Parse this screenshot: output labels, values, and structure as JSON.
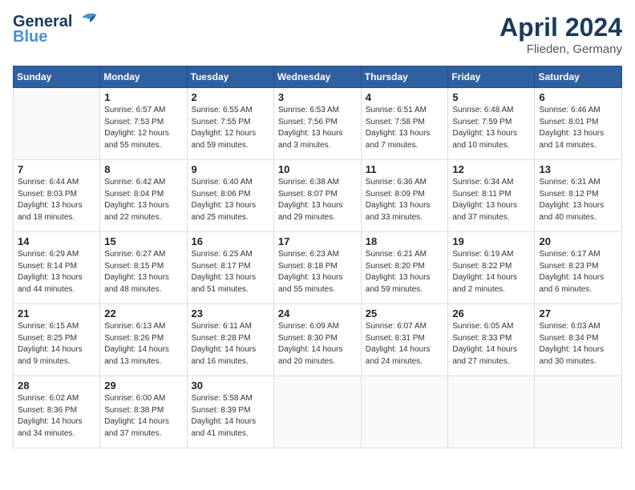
{
  "header": {
    "logo_line1": "General",
    "logo_line2": "Blue",
    "title": "April 2024",
    "subtitle": "Flieden, Germany"
  },
  "days_of_week": [
    "Sunday",
    "Monday",
    "Tuesday",
    "Wednesday",
    "Thursday",
    "Friday",
    "Saturday"
  ],
  "weeks": [
    [
      {
        "day": "",
        "info": ""
      },
      {
        "day": "1",
        "info": "Sunrise: 6:57 AM\nSunset: 7:53 PM\nDaylight: 12 hours\nand 55 minutes."
      },
      {
        "day": "2",
        "info": "Sunrise: 6:55 AM\nSunset: 7:55 PM\nDaylight: 12 hours\nand 59 minutes."
      },
      {
        "day": "3",
        "info": "Sunrise: 6:53 AM\nSunset: 7:56 PM\nDaylight: 13 hours\nand 3 minutes."
      },
      {
        "day": "4",
        "info": "Sunrise: 6:51 AM\nSunset: 7:58 PM\nDaylight: 13 hours\nand 7 minutes."
      },
      {
        "day": "5",
        "info": "Sunrise: 6:48 AM\nSunset: 7:59 PM\nDaylight: 13 hours\nand 10 minutes."
      },
      {
        "day": "6",
        "info": "Sunrise: 6:46 AM\nSunset: 8:01 PM\nDaylight: 13 hours\nand 14 minutes."
      }
    ],
    [
      {
        "day": "7",
        "info": "Sunrise: 6:44 AM\nSunset: 8:03 PM\nDaylight: 13 hours\nand 18 minutes."
      },
      {
        "day": "8",
        "info": "Sunrise: 6:42 AM\nSunset: 8:04 PM\nDaylight: 13 hours\nand 22 minutes."
      },
      {
        "day": "9",
        "info": "Sunrise: 6:40 AM\nSunset: 8:06 PM\nDaylight: 13 hours\nand 25 minutes."
      },
      {
        "day": "10",
        "info": "Sunrise: 6:38 AM\nSunset: 8:07 PM\nDaylight: 13 hours\nand 29 minutes."
      },
      {
        "day": "11",
        "info": "Sunrise: 6:36 AM\nSunset: 8:09 PM\nDaylight: 13 hours\nand 33 minutes."
      },
      {
        "day": "12",
        "info": "Sunrise: 6:34 AM\nSunset: 8:11 PM\nDaylight: 13 hours\nand 37 minutes."
      },
      {
        "day": "13",
        "info": "Sunrise: 6:31 AM\nSunset: 8:12 PM\nDaylight: 13 hours\nand 40 minutes."
      }
    ],
    [
      {
        "day": "14",
        "info": "Sunrise: 6:29 AM\nSunset: 8:14 PM\nDaylight: 13 hours\nand 44 minutes."
      },
      {
        "day": "15",
        "info": "Sunrise: 6:27 AM\nSunset: 8:15 PM\nDaylight: 13 hours\nand 48 minutes."
      },
      {
        "day": "16",
        "info": "Sunrise: 6:25 AM\nSunset: 8:17 PM\nDaylight: 13 hours\nand 51 minutes."
      },
      {
        "day": "17",
        "info": "Sunrise: 6:23 AM\nSunset: 8:18 PM\nDaylight: 13 hours\nand 55 minutes."
      },
      {
        "day": "18",
        "info": "Sunrise: 6:21 AM\nSunset: 8:20 PM\nDaylight: 13 hours\nand 59 minutes."
      },
      {
        "day": "19",
        "info": "Sunrise: 6:19 AM\nSunset: 8:22 PM\nDaylight: 14 hours\nand 2 minutes."
      },
      {
        "day": "20",
        "info": "Sunrise: 6:17 AM\nSunset: 8:23 PM\nDaylight: 14 hours\nand 6 minutes."
      }
    ],
    [
      {
        "day": "21",
        "info": "Sunrise: 6:15 AM\nSunset: 8:25 PM\nDaylight: 14 hours\nand 9 minutes."
      },
      {
        "day": "22",
        "info": "Sunrise: 6:13 AM\nSunset: 8:26 PM\nDaylight: 14 hours\nand 13 minutes."
      },
      {
        "day": "23",
        "info": "Sunrise: 6:11 AM\nSunset: 8:28 PM\nDaylight: 14 hours\nand 16 minutes."
      },
      {
        "day": "24",
        "info": "Sunrise: 6:09 AM\nSunset: 8:30 PM\nDaylight: 14 hours\nand 20 minutes."
      },
      {
        "day": "25",
        "info": "Sunrise: 6:07 AM\nSunset: 8:31 PM\nDaylight: 14 hours\nand 24 minutes."
      },
      {
        "day": "26",
        "info": "Sunrise: 6:05 AM\nSunset: 8:33 PM\nDaylight: 14 hours\nand 27 minutes."
      },
      {
        "day": "27",
        "info": "Sunrise: 6:03 AM\nSunset: 8:34 PM\nDaylight: 14 hours\nand 30 minutes."
      }
    ],
    [
      {
        "day": "28",
        "info": "Sunrise: 6:02 AM\nSunset: 8:36 PM\nDaylight: 14 hours\nand 34 minutes."
      },
      {
        "day": "29",
        "info": "Sunrise: 6:00 AM\nSunset: 8:38 PM\nDaylight: 14 hours\nand 37 minutes."
      },
      {
        "day": "30",
        "info": "Sunrise: 5:58 AM\nSunset: 8:39 PM\nDaylight: 14 hours\nand 41 minutes."
      },
      {
        "day": "",
        "info": ""
      },
      {
        "day": "",
        "info": ""
      },
      {
        "day": "",
        "info": ""
      },
      {
        "day": "",
        "info": ""
      }
    ]
  ]
}
